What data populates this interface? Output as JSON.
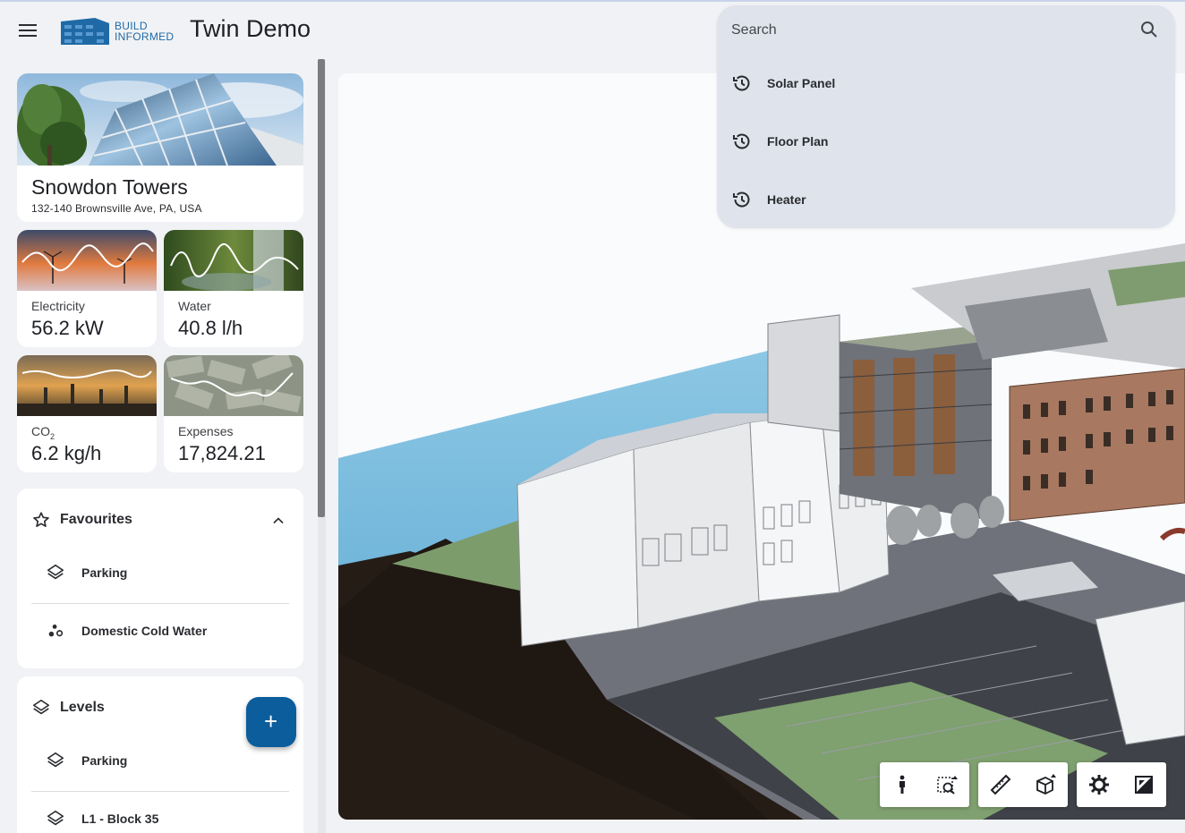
{
  "header": {
    "logo_line1": "BUILD",
    "logo_line2": "INFORMED",
    "title": "Twin Demo"
  },
  "building": {
    "name": "Snowdon Towers",
    "address": "132-140 Brownsville Ave, PA, USA"
  },
  "metrics": {
    "electricity": {
      "label": "Electricity",
      "value": "56.2 kW"
    },
    "water": {
      "label": "Water",
      "value": "40.8 l/h"
    },
    "co2": {
      "label": "CO",
      "label_sub": "2",
      "value": "6.2 kg/h"
    },
    "expenses": {
      "label": "Expenses",
      "value": "17,824.21"
    }
  },
  "favourites": {
    "title": "Favourites",
    "items": [
      {
        "label": "Parking",
        "icon": "layers-icon"
      },
      {
        "label": "Domestic Cold Water",
        "icon": "scatter-icon"
      }
    ]
  },
  "levels": {
    "title": "Levels",
    "items": [
      {
        "label": "Parking",
        "icon": "layers-icon"
      },
      {
        "label": "L1 - Block 35",
        "icon": "layers-icon"
      }
    ]
  },
  "search": {
    "placeholder": "Search",
    "history": [
      {
        "label": "Solar Panel",
        "icon": "history-icon"
      },
      {
        "label": "Floor Plan",
        "icon": "history-icon"
      },
      {
        "label": "Heater",
        "icon": "history-icon"
      }
    ]
  },
  "colors": {
    "brand": "#1f6aa6",
    "fab": "#0b5d9c",
    "search_bg": "#dfe3ec"
  }
}
